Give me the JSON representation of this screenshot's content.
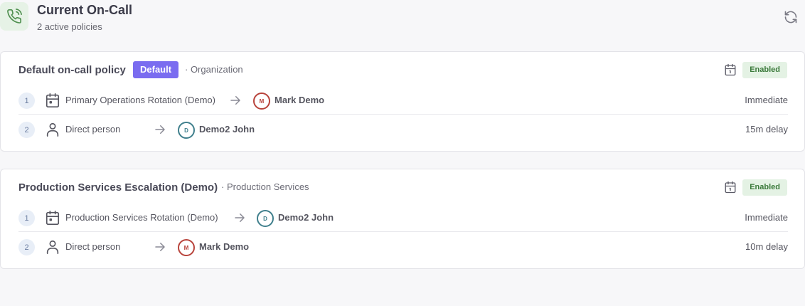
{
  "header": {
    "title": "Current On-Call",
    "subtitle": "2 active policies",
    "icon": "phone-call-icon",
    "accent": "#5a9a5a"
  },
  "policies": [
    {
      "title": "Default on-call policy",
      "default_badge": "Default",
      "scope": "· Organization",
      "status": "Enabled",
      "steps": [
        {
          "num": "1",
          "icon": "calendar-icon",
          "label": "Primary Operations Rotation (Demo)",
          "initial": "M",
          "person": "Mark Demo",
          "delay": "Immediate"
        },
        {
          "num": "2",
          "icon": "person-icon",
          "label": "Direct person",
          "initial": "D",
          "person": "Demo2 John",
          "delay": "15m delay"
        }
      ]
    },
    {
      "title": "Production Services Escalation (Demo)",
      "scope": "· Production Services",
      "status": "Enabled",
      "steps": [
        {
          "num": "1",
          "icon": "calendar-icon",
          "label": "Production Services Rotation (Demo)",
          "initial": "D",
          "person": "Demo2 John",
          "delay": "Immediate"
        },
        {
          "num": "2",
          "icon": "person-icon",
          "label": "Direct person",
          "initial": "M",
          "person": "Mark Demo",
          "delay": "10m delay"
        }
      ]
    }
  ],
  "colors": {
    "default_badge": "#7a6cf0",
    "enabled_bg": "#e4f2e4",
    "enabled_text": "#3b7a3b",
    "avatar_mark": "#b8433b",
    "avatar_john": "#3f7f8c"
  }
}
